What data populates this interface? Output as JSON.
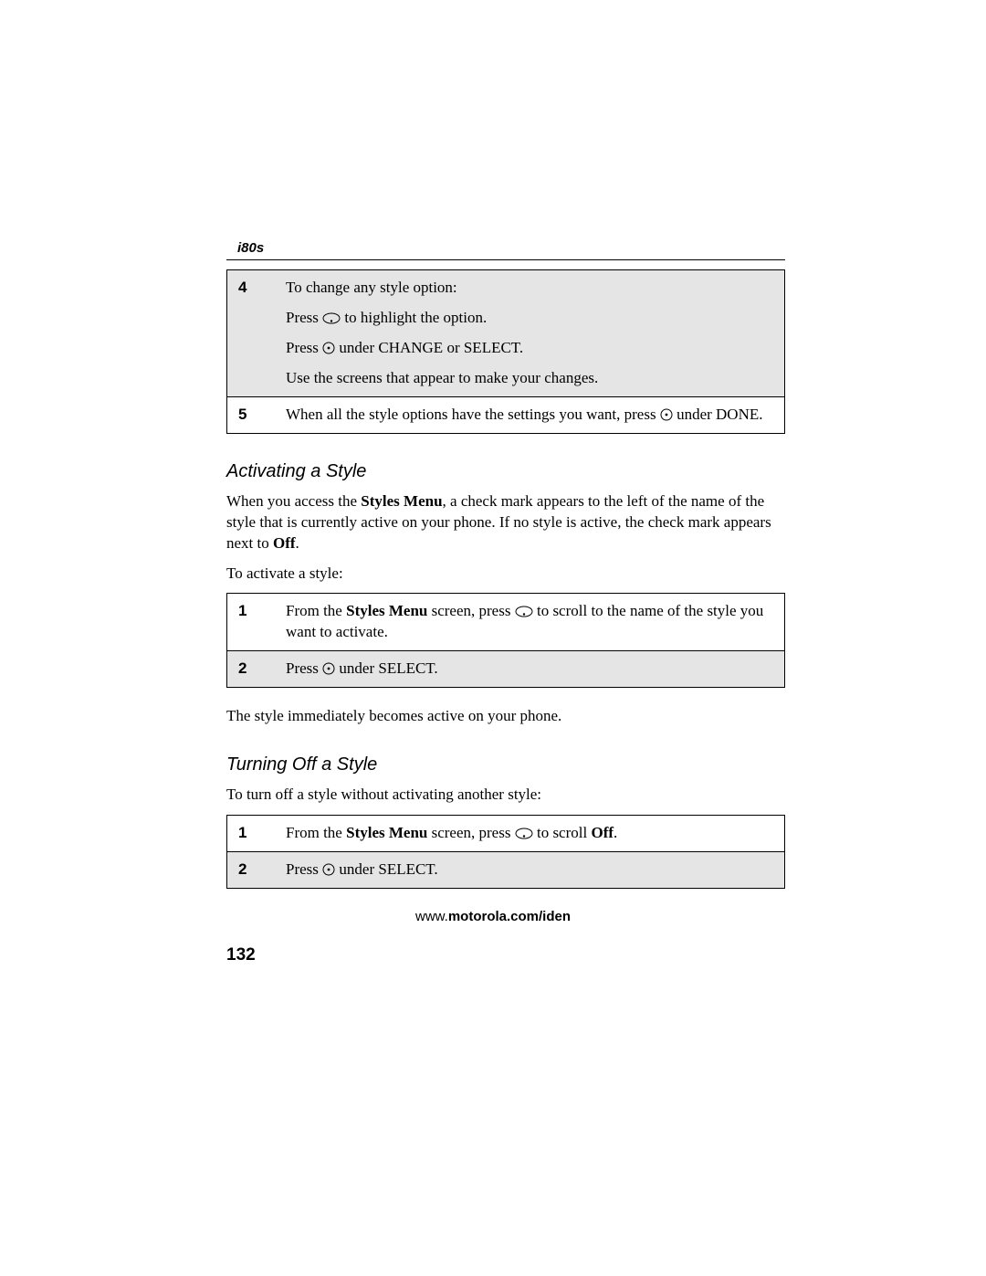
{
  "header": {
    "model": "i80s"
  },
  "table1": {
    "rows": [
      {
        "num": "4",
        "paras": [
          {
            "segments": [
              {
                "t": "To change any style option:"
              }
            ]
          },
          {
            "segments": [
              {
                "t": "Press "
              },
              {
                "icon": "scroll"
              },
              {
                "t": " to highlight the option."
              }
            ]
          },
          {
            "segments": [
              {
                "t": "Press "
              },
              {
                "icon": "softkey"
              },
              {
                "t": " under CHANGE or SELECT."
              }
            ]
          },
          {
            "segments": [
              {
                "t": "Use the screens that appear to make your changes."
              }
            ]
          }
        ],
        "shaded": true
      },
      {
        "num": "5",
        "paras": [
          {
            "segments": [
              {
                "t": "When all the style options have the settings you want, press "
              },
              {
                "icon": "softkey"
              },
              {
                "t": " under DONE."
              }
            ]
          }
        ],
        "shaded": false
      }
    ]
  },
  "section1": {
    "title": "Activating a Style",
    "para1_segments": [
      {
        "t": "When you access the "
      },
      {
        "t": "Styles Menu",
        "b": true
      },
      {
        "t": ", a check mark appears to the left of the name of the style that is currently active on your phone. If no style is active, the check mark appears next to "
      },
      {
        "t": "Off",
        "b": true
      },
      {
        "t": "."
      }
    ],
    "para2": "To activate a style:",
    "table": {
      "rows": [
        {
          "num": "1",
          "paras": [
            {
              "segments": [
                {
                  "t": "From the "
                },
                {
                  "t": "Styles Menu",
                  "b": true
                },
                {
                  "t": " screen, press "
                },
                {
                  "icon": "scroll"
                },
                {
                  "t": " to scroll to the name of the style you want to activate."
                }
              ]
            }
          ],
          "shaded": false
        },
        {
          "num": "2",
          "paras": [
            {
              "segments": [
                {
                  "t": "Press "
                },
                {
                  "icon": "softkey"
                },
                {
                  "t": " under SELECT."
                }
              ]
            }
          ],
          "shaded": true
        }
      ]
    },
    "para3": "The style immediately becomes active on your phone."
  },
  "section2": {
    "title": "Turning Off a Style",
    "para1": "To turn off a style without activating another style:",
    "table": {
      "rows": [
        {
          "num": "1",
          "paras": [
            {
              "segments": [
                {
                  "t": "From the "
                },
                {
                  "t": "Styles Menu",
                  "b": true
                },
                {
                  "t": " screen, press "
                },
                {
                  "icon": "scroll"
                },
                {
                  "t": " to scroll "
                },
                {
                  "t": "Off",
                  "b": true
                },
                {
                  "t": "."
                }
              ]
            }
          ],
          "shaded": false
        },
        {
          "num": "2",
          "paras": [
            {
              "segments": [
                {
                  "t": "Press "
                },
                {
                  "icon": "softkey"
                },
                {
                  "t": " under SELECT."
                }
              ]
            }
          ],
          "shaded": true
        }
      ]
    }
  },
  "footer": {
    "url_pre": "www.",
    "url_bold": "motorola.com/iden"
  },
  "pagenum": "132"
}
